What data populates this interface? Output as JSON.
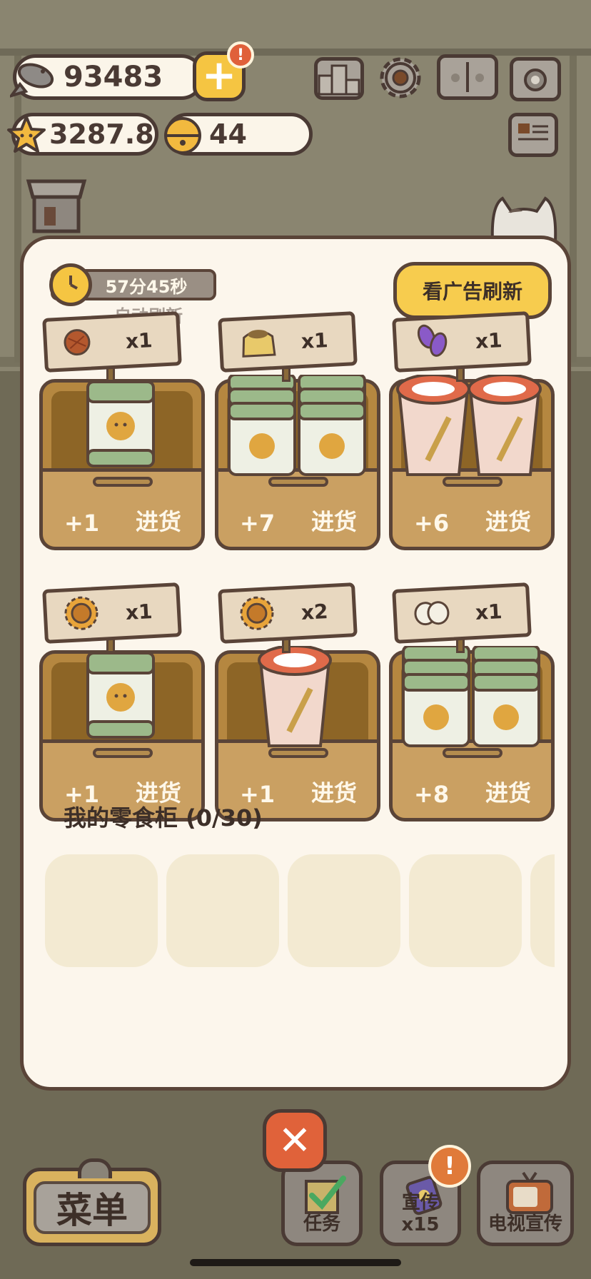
{
  "currency": {
    "fish": "93483",
    "stars": "3287.8",
    "bells": "44",
    "add_label": "+",
    "alert_mark": "!"
  },
  "top_icons": [
    "ranking-icon",
    "gear-icon",
    "paw-book-icon",
    "camera-icon",
    "newspaper-icon"
  ],
  "panel": {
    "timer": "57分45秒",
    "auto_refresh": "自动刷新",
    "ad_refresh": "看广告刷新",
    "cards": [
      {
        "icon": "cookie-icon",
        "qty": "x1",
        "count": "+1",
        "label": "进货",
        "item": "jar-single"
      },
      {
        "icon": "grain-sack-icon",
        "qty": "x1",
        "count": "+7",
        "label": "进货",
        "item": "jar-stack"
      },
      {
        "icon": "grapes-icon",
        "qty": "x1",
        "count": "+6",
        "label": "进货",
        "item": "cup-stack"
      },
      {
        "icon": "sunflower-icon",
        "qty": "x1",
        "count": "+1",
        "label": "进货",
        "item": "jar-single"
      },
      {
        "icon": "sunflower-icon",
        "qty": "x2",
        "count": "+1",
        "label": "进货",
        "item": "cup-single"
      },
      {
        "icon": "rice-ball-icon",
        "qty": "x1",
        "count": "+8",
        "label": "进货",
        "item": "jar-stack"
      }
    ],
    "snack_title": "我的零食柜 (0/30)"
  },
  "close_label": "✕",
  "bottom": {
    "menu": "菜单",
    "tasks": "任务",
    "promo": "宣传x15",
    "tv": "电视宣传"
  },
  "colors": {
    "accent_yellow": "#f7cc4e",
    "alert_orange": "#e0603a",
    "panel_bg": "#fcf6ec",
    "box_brown": "#b58740"
  }
}
